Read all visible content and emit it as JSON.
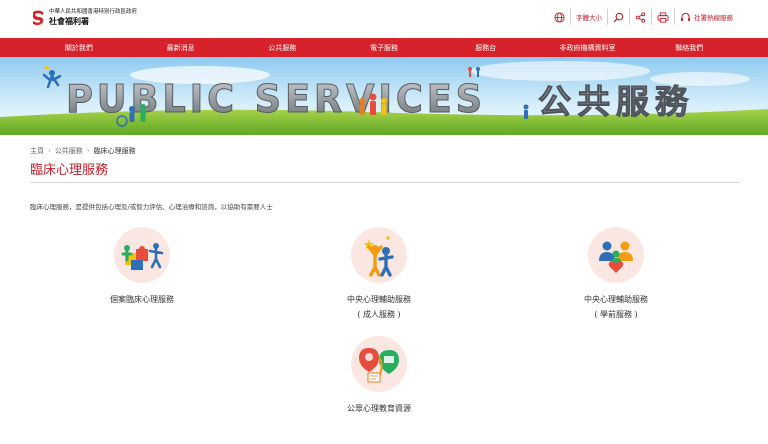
{
  "header": {
    "logo_line1": "中華人民共和國香港特別行政區政府",
    "logo_line2": "社會福利署",
    "tools": {
      "font_size": "字體大小",
      "hotline": "社署熱線服務"
    }
  },
  "nav": {
    "items": [
      "關於我們",
      "最新消息",
      "公共服務",
      "電子服務",
      "服務台",
      "非政府機構資料室",
      "聯絡我們"
    ]
  },
  "banner": {
    "english": "PUBLIC SERVICES",
    "chinese": "公共服務"
  },
  "breadcrumb": {
    "home": "主頁",
    "section": "公共服務",
    "current": "臨床心理服務"
  },
  "page_title": "臨床心理服務",
  "intro": "臨床心理服務，是提供包括心理及/或智力評估、心理治療和諮詢，以協助有需要人士",
  "services": [
    {
      "line1": "個案臨床心理服務",
      "line2": ""
    },
    {
      "line1": "中央心理輔助服務",
      "line2": "( 成人服務 )"
    },
    {
      "line1": "中央心理輔助服務",
      "line2": "( 學前服務 )"
    },
    {
      "line1": "公眾心理教育資源",
      "line2": ""
    }
  ],
  "colors": {
    "brand_red": "#d7222b",
    "title_red": "#c41e2a",
    "icon_circle": "#fbe7e1"
  }
}
